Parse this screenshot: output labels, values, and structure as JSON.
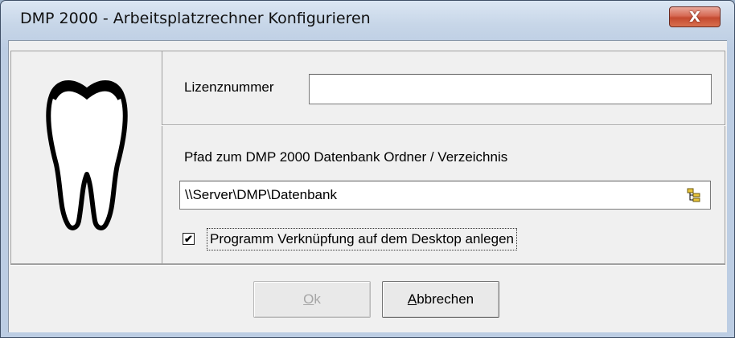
{
  "window": {
    "title": "DMP 2000 - Arbeitsplatzrechner Konfigurieren",
    "close_glyph": "X"
  },
  "license": {
    "label": "Lizenznummer",
    "value": ""
  },
  "path": {
    "label": "Pfad zum DMP 2000 Datenbank Ordner / Verzeichnis",
    "value": "\\\\Server\\DMP\\Datenbank",
    "browse_icon": "folder-tree-icon"
  },
  "shortcut": {
    "checked": true,
    "check_mark": "✔",
    "label": "Programm Verknüpfung auf dem Desktop anlegen"
  },
  "buttons": {
    "ok_mnemonic": "O",
    "ok_rest": "k",
    "cancel_mnemonic": "A",
    "cancel_rest": "bbrechen"
  },
  "logo": {
    "icon": "tooth-icon"
  }
}
